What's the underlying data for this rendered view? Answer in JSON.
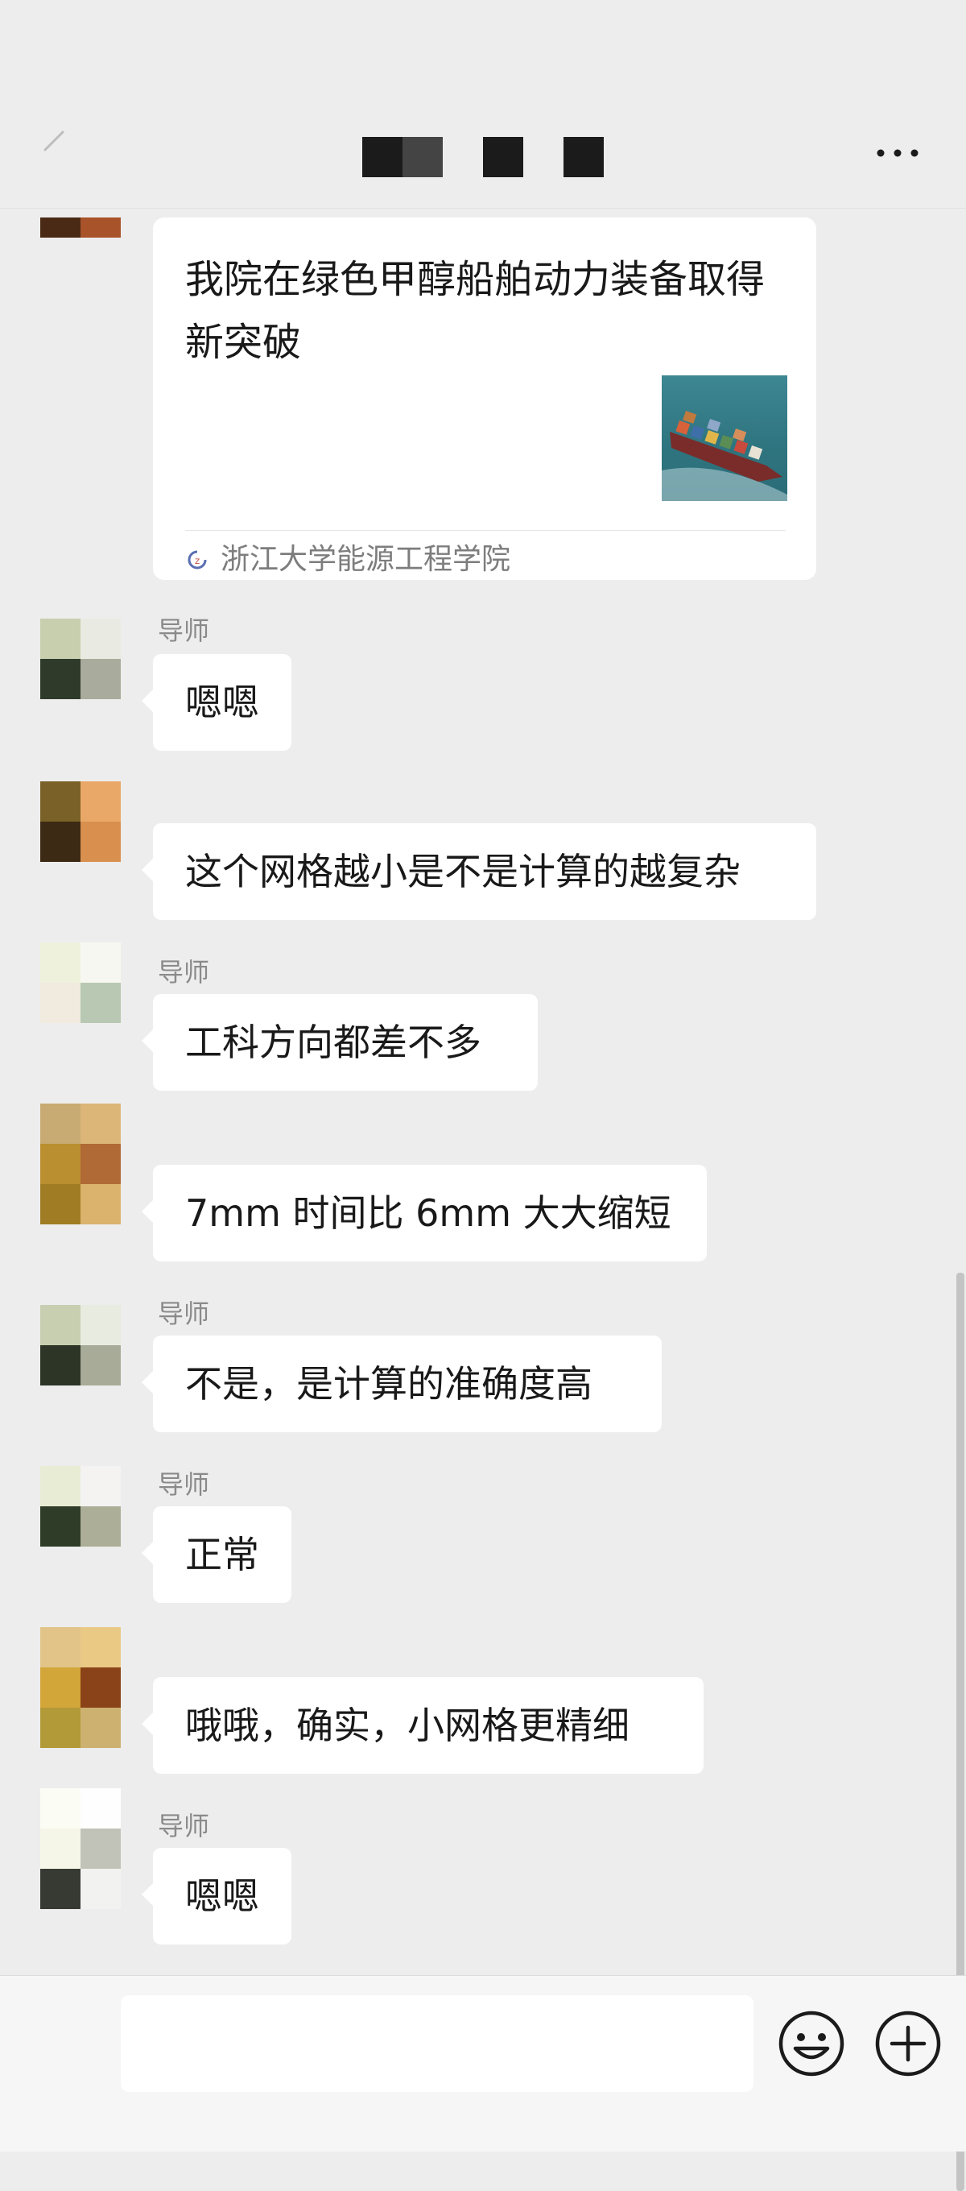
{
  "header": {
    "back_icon": "back-arrow-icon",
    "title": "",
    "more_icon": "more-dots-icon"
  },
  "shared_article": {
    "title": "我院在绿色甲醇船舶动力装备取得新突破",
    "source_name": "浙江大学能源工程学院",
    "thumbnail_icon": "container-ship-image"
  },
  "messages": [
    {
      "sender_label": "导师",
      "text": "嗯嗯"
    },
    {
      "sender_label": "",
      "text": "这个网格越小是不是计算的越复杂"
    },
    {
      "sender_label": "导师",
      "text": "工科方向都差不多"
    },
    {
      "sender_label": "",
      "text": "7mm 时间比 6mm 大大缩短"
    },
    {
      "sender_label": "导师",
      "text": "不是，是计算的准确度高"
    },
    {
      "sender_label": "导师",
      "text": "正常"
    },
    {
      "sender_label": "",
      "text": "哦哦，确实，小网格更精细"
    },
    {
      "sender_label": "导师",
      "text": "嗯嗯"
    }
  ],
  "input_bar": {
    "placeholder": "",
    "emoji_icon": "smiley-face-icon",
    "plus_icon": "plus-circle-icon"
  },
  "colors": {
    "chat_background": "#ededed",
    "bubble_background": "#ffffff",
    "muted_text": "#8a8a8a"
  }
}
